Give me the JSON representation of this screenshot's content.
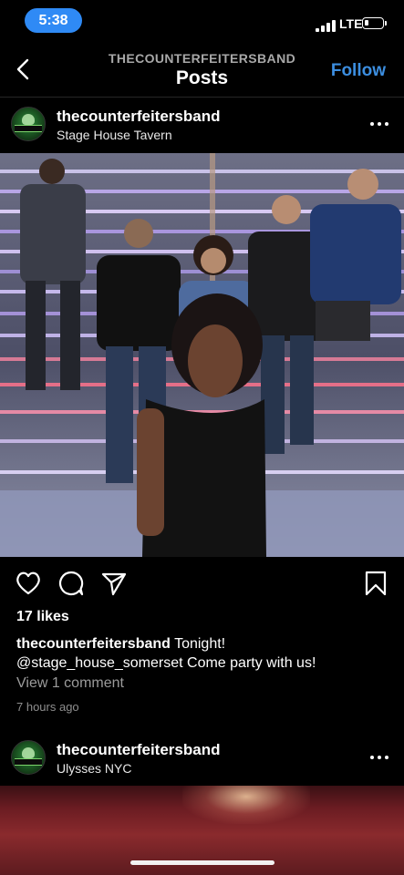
{
  "status_bar": {
    "time": "5:38",
    "network": "LTE"
  },
  "header": {
    "account": "THECOUNTERFEITERSBAND",
    "title": "Posts",
    "follow_label": "Follow"
  },
  "posts": [
    {
      "username": "thecounterfeitersband",
      "location": "Stage House Tavern",
      "likes": "17 likes",
      "caption_user": "thecounterfeitersband",
      "caption_text": "Tonight! @stage_house_somerset Come party with us!",
      "view_comments": "View 1 comment",
      "time_ago": "7 hours ago"
    },
    {
      "username": "thecounterfeitersband",
      "location": "Ulysses NYC"
    }
  ],
  "icons": {
    "back": "chevron-left-icon",
    "more": "more-horizontal-icon",
    "like": "heart-icon",
    "comment": "comment-icon",
    "share": "paper-plane-icon",
    "save": "bookmark-icon"
  }
}
